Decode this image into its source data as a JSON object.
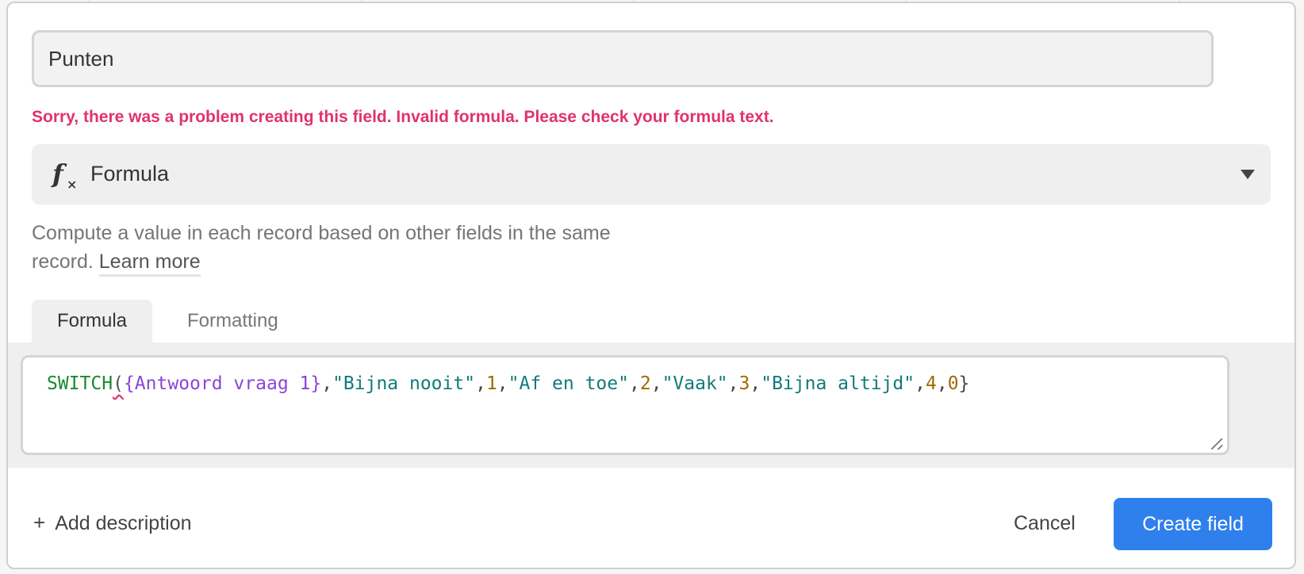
{
  "field": {
    "name_value": "Punten"
  },
  "error_message": "Sorry, there was a problem creating this field. Invalid formula. Please check your formula text.",
  "type_select": {
    "icon": "formula-fx-icon",
    "label": "Formula"
  },
  "description": {
    "text": "Compute a value in each record based on other fields in the same record.",
    "link": "Learn more"
  },
  "tabs": [
    {
      "label": "Formula",
      "active": true
    },
    {
      "label": "Formatting",
      "active": false
    }
  ],
  "formula": {
    "fn": "SWITCH",
    "open": "(",
    "field_ref": "{Antwoord vraag 1}",
    "sep": ",",
    "s1": "\"Bijna nooit\"",
    "n1": "1",
    "s2": "\"Af en toe\"",
    "n2": "2",
    "s3": "\"Vaak\"",
    "n3": "3",
    "s4": "\"Bijna altijd\"",
    "n4": "4",
    "n0": "0",
    "close": "}"
  },
  "footer": {
    "add_description": "Add description",
    "cancel": "Cancel",
    "create": "Create field"
  },
  "colors": {
    "error": "#e0336b",
    "primary": "#2f80ed"
  }
}
